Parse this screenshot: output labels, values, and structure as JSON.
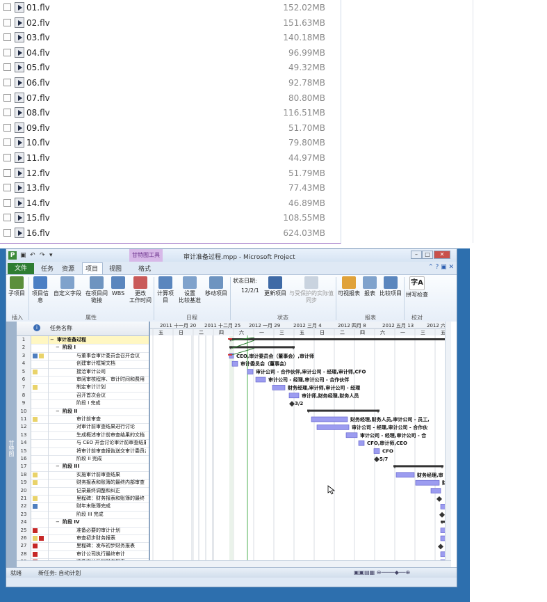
{
  "file_list": [
    {
      "name": "01.flv",
      "size": "152.02MB"
    },
    {
      "name": "02.flv",
      "size": "151.63MB"
    },
    {
      "name": "03.flv",
      "size": "140.18MB"
    },
    {
      "name": "04.flv",
      "size": "96.99MB"
    },
    {
      "name": "05.flv",
      "size": "49.32MB"
    },
    {
      "name": "06.flv",
      "size": "92.78MB"
    },
    {
      "name": "07.flv",
      "size": "80.80MB"
    },
    {
      "name": "08.flv",
      "size": "116.51MB"
    },
    {
      "name": "09.flv",
      "size": "51.70MB"
    },
    {
      "name": "10.flv",
      "size": "79.80MB"
    },
    {
      "name": "11.flv",
      "size": "44.97MB"
    },
    {
      "name": "12.flv",
      "size": "51.79MB"
    },
    {
      "name": "13.flv",
      "size": "77.43MB"
    },
    {
      "name": "14.flv",
      "size": "46.89MB"
    },
    {
      "name": "15.flv",
      "size": "108.55MB"
    },
    {
      "name": "16.flv",
      "size": "624.03MB"
    }
  ],
  "project": {
    "window_title": "审计准备过程.mpp - Microsoft Project",
    "contextual_tab": "甘特图工具",
    "tabs": {
      "file": "文件",
      "task": "任务",
      "resource": "资源",
      "project": "项目",
      "view": "视图",
      "format": "格式"
    },
    "ribbon": {
      "subproject": "子项目",
      "project_info": "项目信息",
      "custom_fields": "自定义字段",
      "links": "在项目间\n链接",
      "wbs": "WBS",
      "change_working_time": "更改\n工作时间",
      "calculate_project": "计算项目",
      "set_baseline": "设置\n比较基准",
      "move_project": "移动项目",
      "status_date_label": "状态日期:",
      "status_date_value": "12/2/1",
      "update_project": "更新项目",
      "sync_protected": "与受保护的实际值\n同步",
      "visual_reports": "可视报表",
      "reports": "报表",
      "compare_projects": "比较项目",
      "spelling": "拼写检查",
      "groups": {
        "insert": "插入",
        "properties": "属性",
        "schedule": "日程",
        "status": "状态",
        "reports": "报表",
        "proofing": "校对"
      }
    },
    "sidebar_label": "甘特图",
    "grid_header": {
      "task_name": "任务名称"
    },
    "timeline_top": [
      "2011 十一月 20",
      "2011 十二月 25",
      "2012 一月 29",
      "2012 三月 4",
      "2012 四月 8",
      "2012 五月 13",
      "2012 六"
    ],
    "timeline_days": [
      "五",
      "日",
      "二",
      "四",
      "六",
      "一",
      "三",
      "五",
      "日",
      "二",
      "四",
      "六",
      "一",
      "三",
      "五"
    ],
    "tasks": [
      {
        "id": "1",
        "name": "审计准备过程",
        "level": 0,
        "summary": true
      },
      {
        "id": "2",
        "name": "阶段 I",
        "level": 1,
        "summary": true
      },
      {
        "id": "3",
        "name": "与董事会审计委员会召开会议",
        "level": 2
      },
      {
        "id": "4",
        "name": "创建审计框架文档",
        "level": 2
      },
      {
        "id": "5",
        "name": "接洽审计公司",
        "level": 2
      },
      {
        "id": "6",
        "name": "审阅审核程序、审计时间和费用",
        "level": 2
      },
      {
        "id": "7",
        "name": "制定审计计划",
        "level": 2
      },
      {
        "id": "8",
        "name": "召开首次会议",
        "level": 2
      },
      {
        "id": "9",
        "name": "阶段 I 完成",
        "level": 2
      },
      {
        "id": "10",
        "name": "阶段 II",
        "level": 1,
        "summary": true
      },
      {
        "id": "11",
        "name": "审计前审查",
        "level": 2
      },
      {
        "id": "12",
        "name": "对审计前审查结果进行讨论",
        "level": 2
      },
      {
        "id": "13",
        "name": "生成概述审计前审查结果的文档",
        "level": 2
      },
      {
        "id": "14",
        "name": "与 CEO 开会讨论审计前审查结果",
        "level": 2
      },
      {
        "id": "15",
        "name": "将审计前审查报告送交审计委员会",
        "level": 2
      },
      {
        "id": "16",
        "name": "阶段 II 完成",
        "level": 2
      },
      {
        "id": "17",
        "name": "阶段 III",
        "level": 1,
        "summary": true
      },
      {
        "id": "18",
        "name": "实施审计前审查结果",
        "level": 2
      },
      {
        "id": "19",
        "name": "财务报表和账簿的最终内部审查",
        "level": 2
      },
      {
        "id": "20",
        "name": "记录最终调整和纠正",
        "level": 2
      },
      {
        "id": "21",
        "name": "里程碑：财务报表和账簿的最终",
        "level": 2
      },
      {
        "id": "22",
        "name": "财年末账簿完成",
        "level": 2
      },
      {
        "id": "23",
        "name": "阶段 III 完成",
        "level": 2
      },
      {
        "id": "24",
        "name": "阶段 IV",
        "level": 1,
        "summary": true
      },
      {
        "id": "25",
        "name": "准备必要的审计计划",
        "level": 2
      },
      {
        "id": "26",
        "name": "审查初步财务报表",
        "level": 2
      },
      {
        "id": "27",
        "name": "里程碑：发布初步财务报表",
        "level": 2
      },
      {
        "id": "28",
        "name": "审计公司执行最终审计",
        "level": 2
      },
      {
        "id": "29",
        "name": "准备审计后的财务报表",
        "level": 2
      }
    ],
    "gantt_labels": [
      {
        "row": 3,
        "text": "CEO,审计委员会（董事会）,审计师"
      },
      {
        "row": 4,
        "text": "审计委员会（董事会）"
      },
      {
        "row": 5,
        "text": "审计公司 - 合作伙伴,审计公司 - 经理,审计师,CFO"
      },
      {
        "row": 6,
        "text": "审计公司 - 经理,审计公司 - 合作伙伴"
      },
      {
        "row": 7,
        "text": "财务经理,审计师,审计公司 - 经理"
      },
      {
        "row": 8,
        "text": "审计师,财务经理,财务人员"
      },
      {
        "row": 9,
        "text": "3/2"
      },
      {
        "row": 11,
        "text": "财务经理,财务人员,审计公司 - 员工,"
      },
      {
        "row": 12,
        "text": "审计公司 - 经理,审计公司 - 合作伙"
      },
      {
        "row": 13,
        "text": "审计公司 - 经理,审计公司 - 合"
      },
      {
        "row": 14,
        "text": "CFO,审计师,CEO"
      },
      {
        "row": 15,
        "text": "CFO"
      },
      {
        "row": 16,
        "text": "5/7"
      },
      {
        "row": 18,
        "text": "财务经理,审"
      },
      {
        "row": 19,
        "text": "财务经"
      }
    ],
    "status_bar": {
      "ready": "就绪",
      "new_task": "新任务: 自动计划"
    }
  }
}
